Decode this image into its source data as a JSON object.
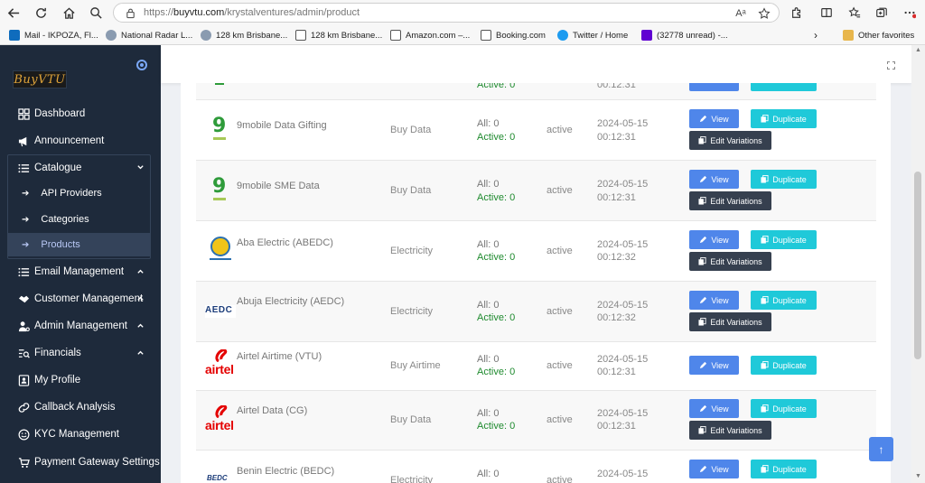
{
  "browser": {
    "url_prefix": "https://",
    "url_host": "buyvtu.com",
    "url_path": "/krystalventures/admin/product",
    "bookmarks": [
      {
        "label": "Mail - IKPOZA, Fl...",
        "icon": "outlook-icon",
        "color": "#0f6cbd"
      },
      {
        "label": "National Radar L...",
        "icon": "globe-icon",
        "color": "#8a9bb0"
      },
      {
        "label": "128 km Brisbane...",
        "icon": "globe-icon",
        "color": "#8a9bb0"
      },
      {
        "label": "128 km Brisbane...",
        "icon": "page-icon",
        "color": "#555555"
      },
      {
        "label": "Amazon.com –...",
        "icon": "page-icon",
        "color": "#555555"
      },
      {
        "label": "Booking.com",
        "icon": "page-icon",
        "color": "#555555"
      },
      {
        "label": "Twitter / Home",
        "icon": "twitter-icon",
        "color": "#1d9bf0"
      },
      {
        "label": "(32778 unread) -...",
        "icon": "yahoo-icon",
        "color": "#6001d2"
      }
    ],
    "other_favorites": "Other favorites"
  },
  "sidebar": {
    "logo_text": "BuyVTU",
    "items": [
      {
        "label": "Dashboard",
        "icon": "dashboard-icon"
      },
      {
        "label": "Announcement",
        "icon": "megaphone-icon"
      },
      {
        "label": "Catalogue",
        "icon": "list-icon"
      },
      {
        "label": "Email Management",
        "icon": "list-icon"
      },
      {
        "label": "Customer Management",
        "icon": "handshake-icon"
      },
      {
        "label": "Admin Management",
        "icon": "user-gear-icon"
      },
      {
        "label": "Financials",
        "icon": "search-list-icon"
      },
      {
        "label": "My Profile",
        "icon": "profile-icon"
      },
      {
        "label": "Callback Analysis",
        "icon": "link-icon"
      },
      {
        "label": "KYC Management",
        "icon": "smiley-icon"
      },
      {
        "label": "Payment Gateway Settings",
        "icon": "cart-icon"
      }
    ],
    "catalogue_sub": [
      {
        "label": "API Providers"
      },
      {
        "label": "Categories"
      },
      {
        "label": "Products"
      }
    ]
  },
  "table": {
    "view_label": "View",
    "duplicate_label": "Duplicate",
    "edit_label": "Edit Variations",
    "rows": [
      {
        "name": "",
        "category": "",
        "all": "",
        "active_count": "Active: 0",
        "status": "",
        "date": "",
        "time": "00:12:31",
        "logo": "9mobile"
      },
      {
        "name": "9mobile Data Gifting",
        "category": "Buy Data",
        "all": "All: 0",
        "active_count": "Active: 0",
        "status": "active",
        "date": "2024-05-15",
        "time": "00:12:31",
        "logo": "9mobile"
      },
      {
        "name": "9mobile SME Data",
        "category": "Buy Data",
        "all": "All: 0",
        "active_count": "Active: 0",
        "status": "active",
        "date": "2024-05-15",
        "time": "00:12:31",
        "logo": "9mobile"
      },
      {
        "name": "Aba Electric (ABEDC)",
        "category": "Electricity",
        "all": "All: 0",
        "active_count": "Active: 0",
        "status": "active",
        "date": "2024-05-15",
        "time": "00:12:32",
        "logo": "abedc"
      },
      {
        "name": "Abuja Electricity (AEDC)",
        "category": "Electricity",
        "all": "All: 0",
        "active_count": "Active: 0",
        "status": "active",
        "date": "2024-05-15",
        "time": "00:12:32",
        "logo": "aedc"
      },
      {
        "name": "Airtel Airtime (VTU)",
        "category": "Buy Airtime",
        "all": "All: 0",
        "active_count": "Active: 0",
        "status": "active",
        "date": "2024-05-15",
        "time": "00:12:31",
        "logo": "airtel"
      },
      {
        "name": "Airtel Data (CG)",
        "category": "Buy Data",
        "all": "All: 0",
        "active_count": "Active: 0",
        "status": "active",
        "date": "2024-05-15",
        "time": "00:12:31",
        "logo": "airtel"
      },
      {
        "name": "Benin Electric (BEDC)",
        "category": "Electricity",
        "all": "All: 0",
        "active_count": "",
        "status": "active",
        "date": "2024-05-15",
        "time": "",
        "logo": "bedc"
      }
    ]
  },
  "logo_texts": {
    "nine_mobile": "9",
    "aedc": "AEDC",
    "airtel": "airtel",
    "bedc": "BEDC"
  },
  "colors": {
    "sidebar_bg": "#1e2a3b",
    "view_button": "#4f86ea",
    "duplicate_button": "#1fc9d9",
    "edit_button": "#36404f",
    "active_green": "#1e8a2e"
  }
}
